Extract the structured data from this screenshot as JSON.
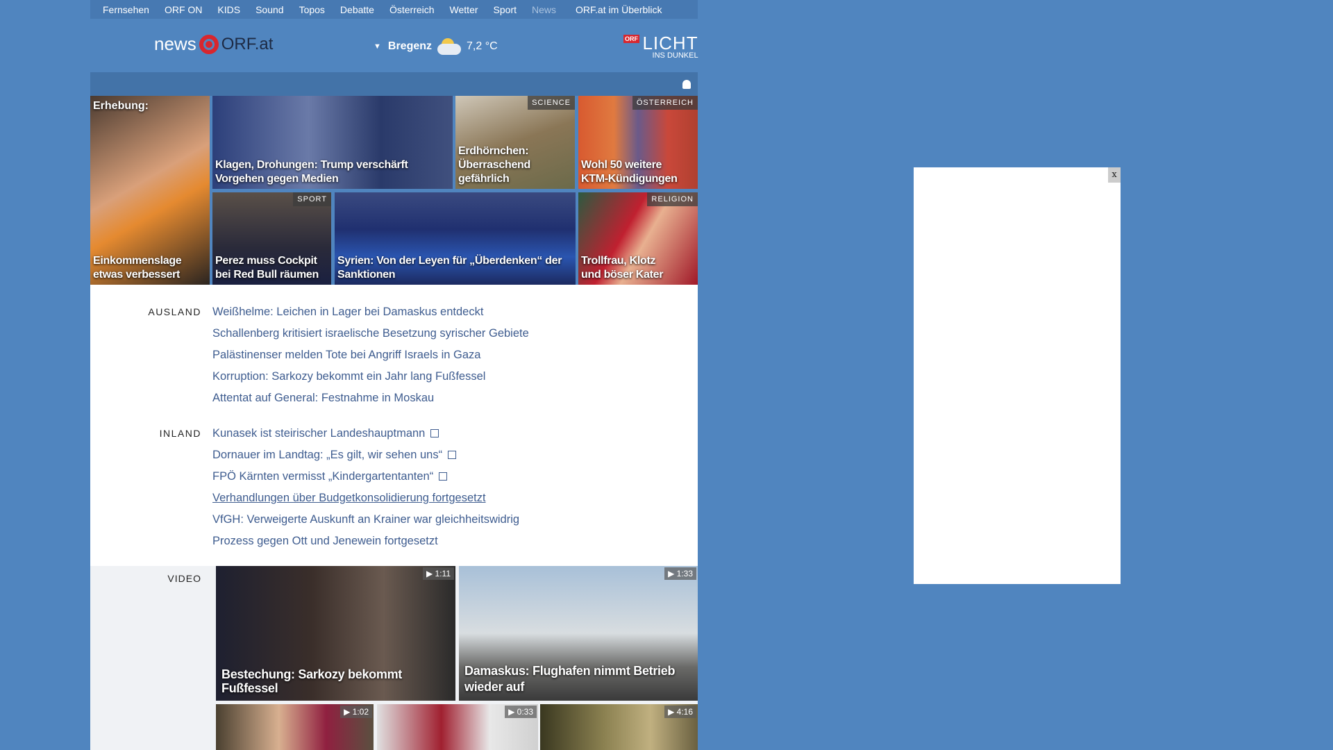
{
  "nav": {
    "items": [
      "Fernsehen",
      "ORF ON",
      "KIDS",
      "Sound",
      "Topos",
      "Debatte",
      "Österreich",
      "Wetter",
      "Sport",
      "News"
    ],
    "overview": "ORF.at im Überblick"
  },
  "header": {
    "logo_news": "news",
    "logo_orf": "ORF.at",
    "weather_city": "Bregenz",
    "weather_temp": "7,2 °C",
    "licht_badge": "ORF",
    "licht_big": "LICHT",
    "licht_small": "INS DUNKEL"
  },
  "tiles": [
    {
      "top": "Erhebung:",
      "caption": "Einkommenslage etwas verbessert"
    },
    {
      "caption": "Klagen, Drohungen: Trump verschärft Vorgehen gegen Medien"
    },
    {
      "tag": "SCIENCE",
      "caption": "Erdhörnchen: Überraschend gefährlich"
    },
    {
      "tag": "ÖSTERREICH",
      "caption": "Wohl 50 weitere KTM-Kündigungen"
    },
    {
      "tag": "SPORT",
      "caption": "Perez muss Cockpit bei Red Bull räumen"
    },
    {
      "caption": "Syrien: Von der Leyen für „Überdenken“ der Sanktionen"
    },
    {
      "tag": "RELIGION",
      "caption": "Trollfrau, Klotz und böser Kater"
    }
  ],
  "ausland": {
    "label": "AUSLAND",
    "items": [
      "Weißhelme: Leichen in Lager bei Damaskus entdeckt",
      "Schallenberg kritisiert israelische Besetzung syrischer Gebiete",
      "Palästinenser melden Tote bei Angriff Israels in Gaza",
      "Korruption: Sarkozy bekommt ein Jahr lang Fußfessel",
      "Attentat auf General: Festnahme in Moskau"
    ]
  },
  "inland": {
    "label": "INLAND",
    "items": [
      "Kunasek ist steirischer Landeshauptmann",
      "Dornauer im Landtag: „Es gilt, wir sehen uns“",
      "FPÖ Kärnten vermisst „Kindergartentanten“",
      "Verhandlungen über Budgetkonsolidierung fortgesetzt",
      "VfGH: Verweigerte Auskunft an Krainer war gleichheitswidrig",
      "Prozess gegen Ott und Jenewein fortgesetzt"
    ]
  },
  "video": {
    "label": "VIDEO",
    "items": [
      {
        "caption": "Bestechung: Sarkozy bekommt Fußfessel",
        "duration": "▶ 1:11"
      },
      {
        "caption": "Damaskus: Flughafen nimmt Betrieb wieder auf",
        "duration": "▶ 1:33"
      },
      {
        "duration": "▶ 1:02"
      },
      {
        "duration": "▶ 0:33"
      },
      {
        "duration": "▶ 4:16"
      }
    ]
  },
  "ad": {
    "close": "x"
  }
}
